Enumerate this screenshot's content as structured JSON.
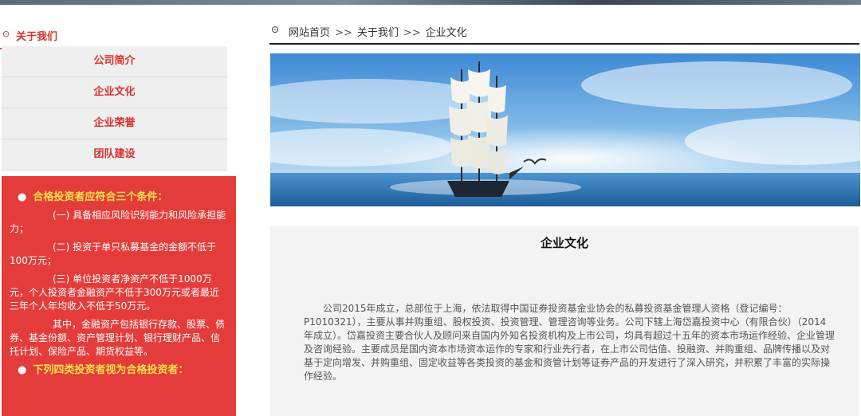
{
  "sidebar": {
    "title": "关于我们",
    "items": [
      {
        "label": "公司简介"
      },
      {
        "label": "企业文化"
      },
      {
        "label": "企业荣誉"
      },
      {
        "label": "团队建设"
      }
    ],
    "notice": {
      "heading1": "合格投资者应符合三个条件：",
      "para1": "(一) 具备相应风险识别能力和风险承担能力；",
      "para2": "(二) 投资于单只私募基金的金额不低于100万元；",
      "para3": "(三) 单位投资者净资产不低于1000万元，个人投资者金融资产不低于300万元或者最近三年个人年均收入不低于50万元。",
      "para4": "其中，金融资产包括银行存款、股票、债券、基金份额、资产管理计划、银行理财产品、信托计划、保险产品、期货权益等。",
      "heading2": "下列四类投资者视为合格投资者："
    }
  },
  "breadcrumb": {
    "home": "网站首页",
    "sep": ">>",
    "level1": "关于我们",
    "level2": "企业文化"
  },
  "article": {
    "title": "企业文化",
    "body": "公司2015年成立，总部位于上海，依法取得中国证券投资基金业协会的私募投资基金管理人资格（登记编号：P1010321），主要从事并购重组、股权投资、投资管理、管理咨询等业务。公司下辖上海岱嘉投资中心（有限合伙）（2014年成立）。岱嘉投资主要合伙人及顾问来自国内外知名投资机构及上市公司，均具有超过十五年的资本市场运作经验、企业管理及咨询经验。主要成员是国内资本市场资本运作的专家和行业先行者，在上市公司估值、投融资、并购重组、品牌传播以及对基于定向增发、并购重组、固定收益等各类投资的基金和资管计划等证券产品的开发进行了深入研究，并积累了丰富的实际操作经验。"
  }
}
